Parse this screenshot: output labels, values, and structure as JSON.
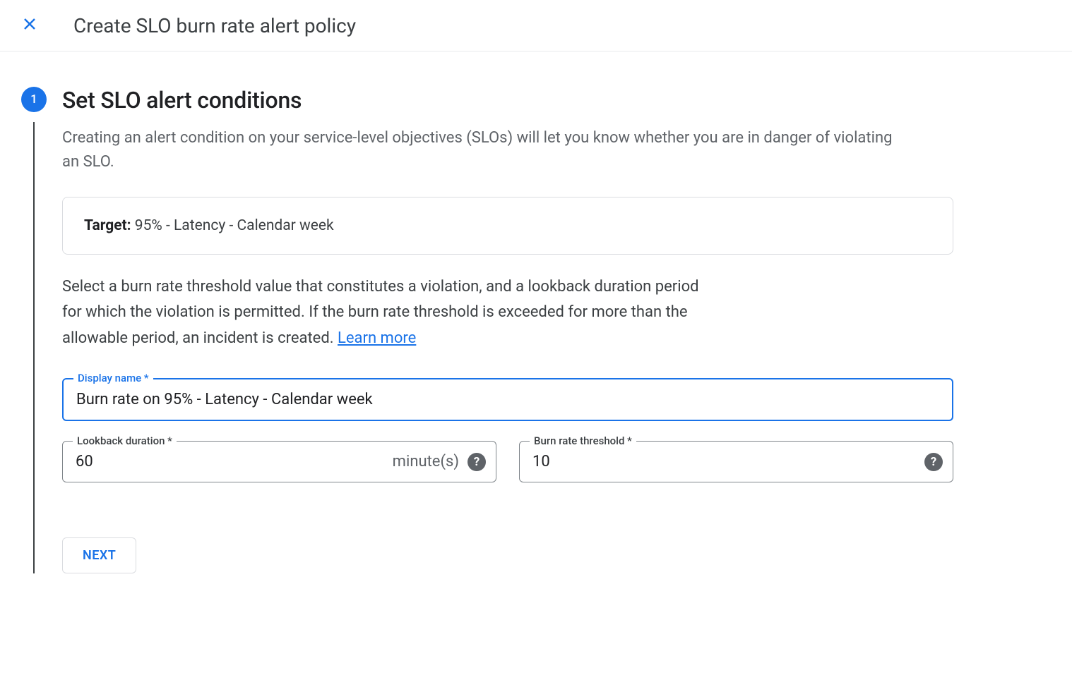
{
  "header": {
    "title": "Create SLO burn rate alert policy"
  },
  "step": {
    "number": "1",
    "title": "Set SLO alert conditions",
    "description": "Creating an alert condition on your service-level objectives (SLOs) will let you know whether you are in danger of violating an SLO.",
    "target": {
      "label": "Target:",
      "value": " 95% - Latency - Calendar week"
    },
    "select_text": "Select a burn rate threshold value that constitutes a violation, and a lookback duration period for which the violation is permitted. If the burn rate threshold is exceeded for more than the allowable period, an incident is created. ",
    "learn_more": "Learn more",
    "fields": {
      "display_name": {
        "label": "Display name *",
        "value": "Burn rate on 95% - Latency - Calendar week"
      },
      "lookback": {
        "label": "Lookback duration *",
        "value": "60",
        "suffix": "minute(s)"
      },
      "threshold": {
        "label": "Burn rate threshold *",
        "value": "10"
      }
    },
    "next_label": "NEXT"
  }
}
